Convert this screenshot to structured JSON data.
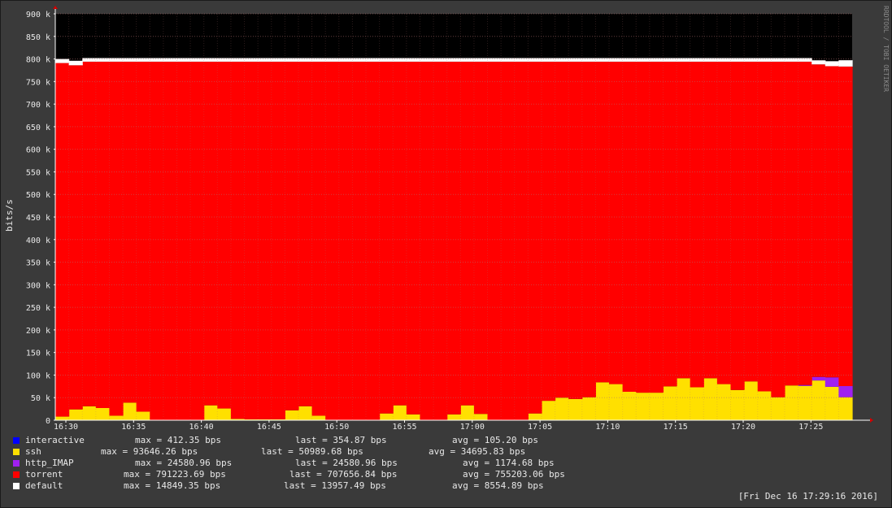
{
  "chart_data": {
    "type": "area",
    "stacked": true,
    "ylabel": "bits/s",
    "ylim": [
      0,
      900000
    ],
    "yticks": [
      "0",
      "50 k",
      "100 k",
      "150 k",
      "200 k",
      "250 k",
      "300 k",
      "350 k",
      "400 k",
      "450 k",
      "500 k",
      "550 k",
      "600 k",
      "650 k",
      "700 k",
      "750 k",
      "800 k",
      "850 k",
      "900 k"
    ],
    "xticks": [
      "16:30",
      "16:35",
      "16:40",
      "16:45",
      "16:50",
      "16:55",
      "17:00",
      "17:05",
      "17:10",
      "17:15",
      "17:20",
      "17:25"
    ],
    "grid": true,
    "legend_position": "bottom-left",
    "background": "#000000",
    "series": [
      {
        "name": "ssh",
        "color": "#ffe000",
        "values": [
          8000,
          24000,
          31000,
          27000,
          10000,
          39000,
          19000,
          0,
          0,
          0,
          0,
          33000,
          26000,
          3000,
          2000,
          2000,
          2000,
          22000,
          31000,
          10000,
          0,
          0,
          0,
          0,
          15000,
          33000,
          13000,
          0,
          0,
          13000,
          33000,
          14000,
          0,
          0,
          0,
          15000,
          43000,
          50000,
          47000,
          51000,
          84000,
          80000,
          63000,
          61000,
          61000,
          75000,
          93000,
          73000,
          93000,
          80000,
          67000,
          86000,
          64000,
          51000,
          77000,
          76000,
          88000,
          74000,
          51000
        ]
      },
      {
        "name": "http_IMAP",
        "color": "#a020f0",
        "values": [
          0,
          0,
          0,
          0,
          0,
          0,
          0,
          0,
          0,
          0,
          0,
          0,
          0,
          0,
          0,
          0,
          0,
          0,
          0,
          0,
          0,
          0,
          0,
          0,
          0,
          0,
          0,
          0,
          0,
          0,
          0,
          0,
          0,
          0,
          0,
          0,
          0,
          0,
          0,
          0,
          0,
          0,
          0,
          0,
          0,
          0,
          0,
          0,
          0,
          0,
          0,
          0,
          0,
          0,
          0,
          2000,
          8000,
          21000,
          24580
        ]
      },
      {
        "name": "torrent",
        "color": "#ff0000",
        "values": [
          783000,
          762000,
          763000,
          767000,
          784000,
          755000,
          775000,
          794000,
          794000,
          794000,
          794000,
          761000,
          768000,
          791000,
          792000,
          792000,
          792000,
          772000,
          763000,
          784000,
          794000,
          794000,
          794000,
          794000,
          779000,
          761000,
          781000,
          794000,
          794000,
          781000,
          761000,
          780000,
          794000,
          794000,
          794000,
          779000,
          751000,
          744000,
          747000,
          743000,
          710000,
          714000,
          731000,
          733000,
          733000,
          719000,
          701000,
          721000,
          701000,
          714000,
          727000,
          708000,
          730000,
          743000,
          717000,
          716000,
          692000,
          689000,
          707656
        ]
      },
      {
        "name": "default",
        "color": "#ffffff",
        "values": [
          9000,
          10000,
          8000,
          8000,
          8000,
          8000,
          8000,
          8000,
          8000,
          8000,
          8000,
          8000,
          8000,
          8000,
          8000,
          8000,
          8000,
          8000,
          8000,
          8000,
          8000,
          8000,
          8000,
          8000,
          8000,
          8000,
          8000,
          8000,
          8000,
          8000,
          8000,
          8000,
          8000,
          8000,
          8000,
          8000,
          8000,
          8000,
          8000,
          8000,
          8000,
          8000,
          8000,
          8000,
          8000,
          8000,
          8000,
          8000,
          8000,
          8000,
          8000,
          8000,
          8000,
          8000,
          8000,
          8000,
          9000,
          11000,
          13957
        ]
      }
    ],
    "legend": [
      {
        "name": "interactive",
        "color": "#0000ff",
        "max": "max = 412.35 bps",
        "last": "last = 354.87 bps",
        "avg": "avg = 105.20 bps"
      },
      {
        "name": "ssh",
        "color": "#ffe000",
        "max": "max = 93646.26 bps",
        "last": "last = 50989.68 bps",
        "avg": "avg = 34695.83 bps"
      },
      {
        "name": "http_IMAP",
        "color": "#a020f0",
        "max": "max = 24580.96 bps",
        "last": "last = 24580.96 bps",
        "avg": "avg = 1174.68 bps"
      },
      {
        "name": "torrent",
        "color": "#ff0000",
        "max": "max = 791223.69 bps",
        "last": "last = 707656.84 bps",
        "avg": "avg = 755203.06 bps"
      },
      {
        "name": "default",
        "color": "#ffffff",
        "max": "max = 14849.35 bps",
        "last": "last = 13957.49 bps",
        "avg": "avg = 8554.89 bps"
      }
    ],
    "timestamp": "[Fri Dec 16 17:29:16 2016]",
    "watermark": "RRDTOOL / TOBI OETIKER"
  }
}
